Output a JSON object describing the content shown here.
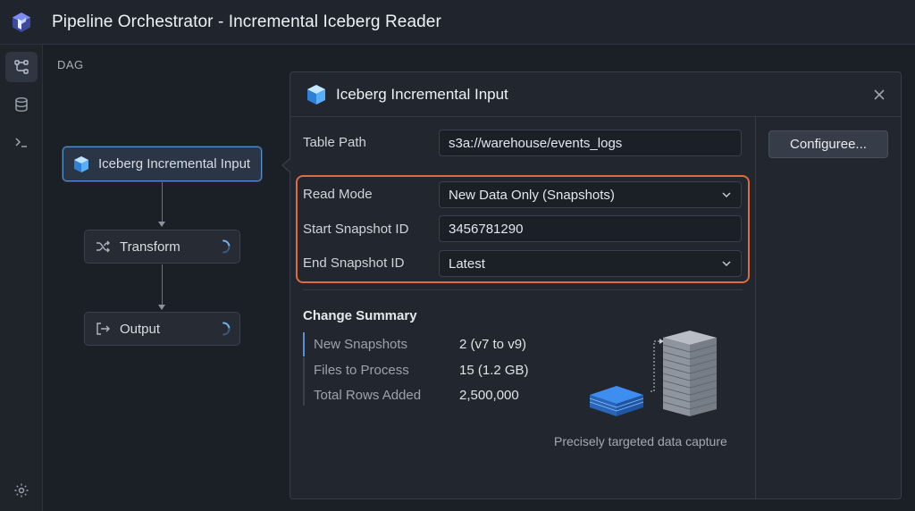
{
  "window": {
    "title": "Pipeline Orchestrator - Incremental Iceberg Reader"
  },
  "rail": {
    "icons": [
      "workflow-icon",
      "database-icon",
      "terminal-icon",
      "settings-gear-icon"
    ]
  },
  "canvas": {
    "label": "DAG",
    "nodes": [
      {
        "label": "Iceberg Incremental Input",
        "icon": "iceberg-cube-icon",
        "selected": true
      },
      {
        "label": "Transform",
        "icon": "shuffle-icon",
        "status": "loading"
      },
      {
        "label": "Output",
        "icon": "exit-arrow-icon",
        "status": "loading"
      }
    ]
  },
  "panel": {
    "title": "Iceberg Incremental Input",
    "fields": {
      "table_path": {
        "label": "Table Path",
        "value": "s3a://warehouse/events_logs"
      },
      "read_mode": {
        "label": "Read Mode",
        "value": "New Data Only (Snapshots)"
      },
      "start_snapshot": {
        "label": "Start Snapshot ID",
        "value": "3456781290"
      },
      "end_snapshot": {
        "label": "End Snapshot ID",
        "value": "Latest"
      }
    },
    "configure_label": "Configuree...",
    "summary": {
      "title": "Change Summary",
      "rows": [
        {
          "label": "New Snapshots",
          "value": "2 (v7 to v9)"
        },
        {
          "label": "Files to Process",
          "value": "15 (1.2 GB)"
        },
        {
          "label": "Total Rows Added",
          "value": "2,500,000"
        }
      ]
    },
    "illustration_caption": "Precisely targeted data capture"
  },
  "colors": {
    "accent": "#5b8fd1",
    "highlight_border": "#e06a3a",
    "background": "#1b1f26"
  }
}
